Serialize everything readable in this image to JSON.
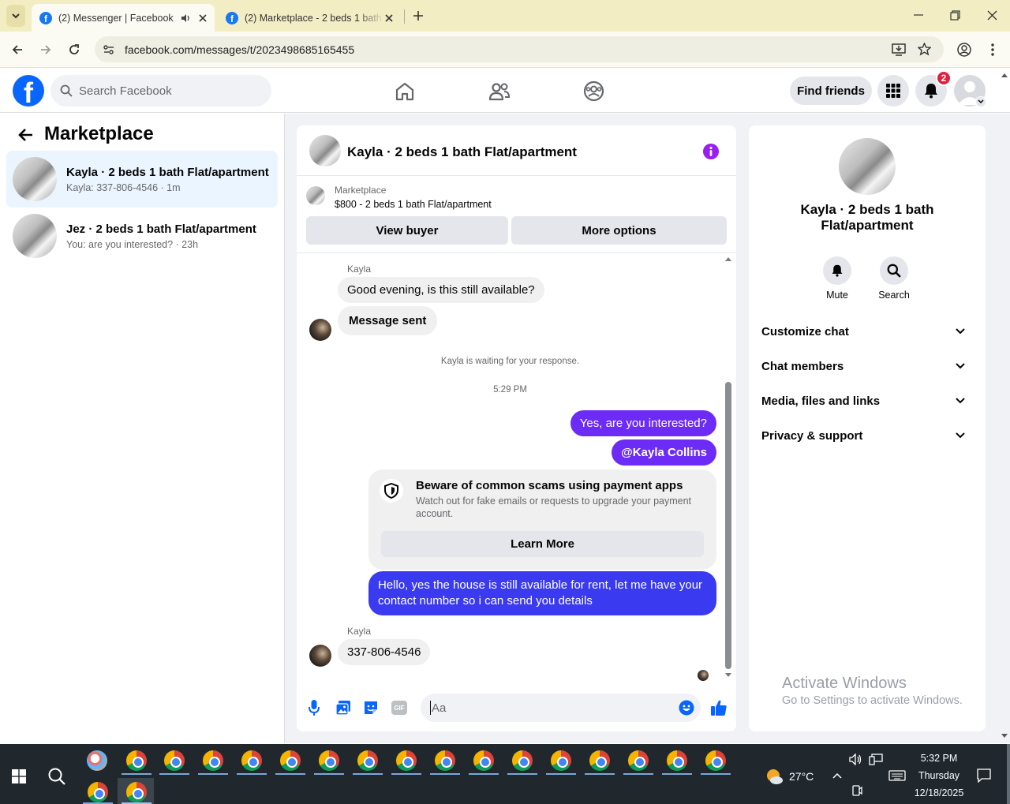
{
  "browser": {
    "tabs": [
      {
        "title": "(2) Messenger | Facebook",
        "active": true
      },
      {
        "title": "(2) Marketplace - 2 beds 1 bath",
        "active": false
      }
    ],
    "url": "facebook.com/messages/t/2023498685165455"
  },
  "header": {
    "logo": "f",
    "search_placeholder": "Search Facebook",
    "find_friends": "Find friends",
    "notif_count": "2"
  },
  "left": {
    "title": "Marketplace",
    "conversations": [
      {
        "title": "Kayla · 2 beds 1 bath Flat/apartment",
        "preview": "Kayla: 337-806-4546 · 1m",
        "active": true
      },
      {
        "title": "Jez · 2 beds 1 bath Flat/apartment",
        "preview": "You: are you interested? · 23h",
        "active": false
      }
    ]
  },
  "chat": {
    "title": "Kayla · 2 beds 1 bath Flat/apartment",
    "listing_label": "Marketplace",
    "listing_title": "$800 - 2 beds 1 bath Flat/apartment",
    "view_buyer": "View buyer",
    "more_options": "More options",
    "sender_name_1": "Kayla",
    "msg_1": "Good evening, is this still available?",
    "msg_2": "Message sent",
    "waiting": "Kayla is waiting for your response.",
    "time": "5:29 PM",
    "out_1": "Yes, are you interested?",
    "out_2": "@Kayla Collins",
    "scam_title": "Beware of common scams using payment apps",
    "scam_body": "Watch out for fake emails or requests to upgrade your payment account.",
    "learn_more": "Learn More",
    "out_3": "Hello, yes the house is still available for rent, let me have your contact number so i can send you details",
    "sender_name_2": "Kayla",
    "msg_3": "337-806-4546",
    "input_placeholder": "Aa",
    "gif": "GIF"
  },
  "right": {
    "title": "Kayla · 2 beds 1 bath Flat/apartment",
    "mute": "Mute",
    "search": "Search",
    "sections": [
      "Customize chat",
      "Chat members",
      "Media, files and links",
      "Privacy & support"
    ],
    "activate_title": "Activate Windows",
    "activate_sub": "Go to Settings to activate Windows."
  },
  "taskbar": {
    "weather": "27°C",
    "time": "5:32 PM",
    "day": "Thursday",
    "date": "12/18/2025"
  },
  "colors": {
    "fb_blue": "#0866ff",
    "outgoing_bubble": "#6c2cf6",
    "outgoing_bubble_alt": "#3a3af0",
    "info_icon": "#9b1df0",
    "notif_badge": "#e41e3f"
  }
}
